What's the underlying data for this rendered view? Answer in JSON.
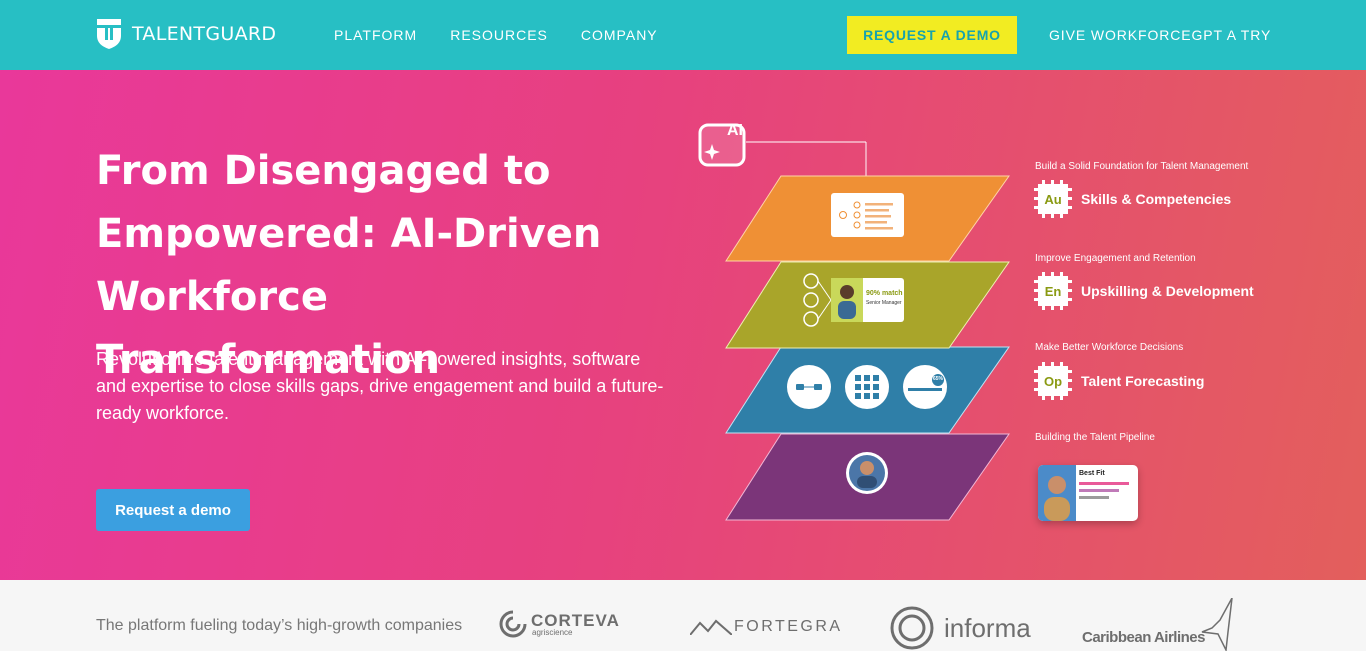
{
  "nav": {
    "brand": "TALENTGUARD",
    "links": [
      "PLATFORM",
      "RESOURCES",
      "COMPANY"
    ],
    "cta": "REQUEST A DEMO",
    "secondary": "GIVE WORKFORCEGPT A TRY"
  },
  "hero": {
    "title": "From Disengaged to Empowered: AI-Driven Workforce Transformation",
    "subtitle": "Revolutionize talent management with AI-powered insights, software and expertise to close skills gaps, drive engagement and build a future-ready workforce.",
    "cta": "Request a demo",
    "ai_badge": "AI"
  },
  "features": [
    {
      "caption": "Build a Solid Foundation for Talent Management",
      "chip": "Au",
      "title": "Skills & Competencies"
    },
    {
      "caption": "Improve Engagement and Retention",
      "chip": "En",
      "title": "Upskilling & Development"
    },
    {
      "caption": "Make Better Workforce Decisions",
      "chip": "Op",
      "title": "Talent Forecasting"
    },
    {
      "caption": "Building the Talent Pipeline",
      "chip": "",
      "title": ""
    }
  ],
  "cards": {
    "match_percent": "90% match",
    "match_role": "Senior Manager",
    "best_fit": "Best Fit",
    "forecast_badge": "65%"
  },
  "clients": {
    "label": "The platform fueling today’s high-growth companies",
    "logos": [
      {
        "name": "CORTEVA",
        "sub": "agriscience"
      },
      {
        "name": "FORTEGRA"
      },
      {
        "name": "informa"
      },
      {
        "name": "Caribbean Airlines"
      }
    ]
  },
  "colors": {
    "nav_bg": "#27bfc4",
    "cta_yellow": "#f2ec22",
    "hero_start": "#e9389a",
    "hero_end": "#e35f5c",
    "hero_button": "#3b9fe0",
    "layer_orange": "#ef9035",
    "layer_olive": "#a9a52a",
    "layer_blue": "#2f7fa8",
    "layer_purple": "#7b3579"
  },
  "icons": [
    "talentguard-shield-icon",
    "ai-sparkle-icon",
    "chip-icon",
    "avatar-icon"
  ]
}
